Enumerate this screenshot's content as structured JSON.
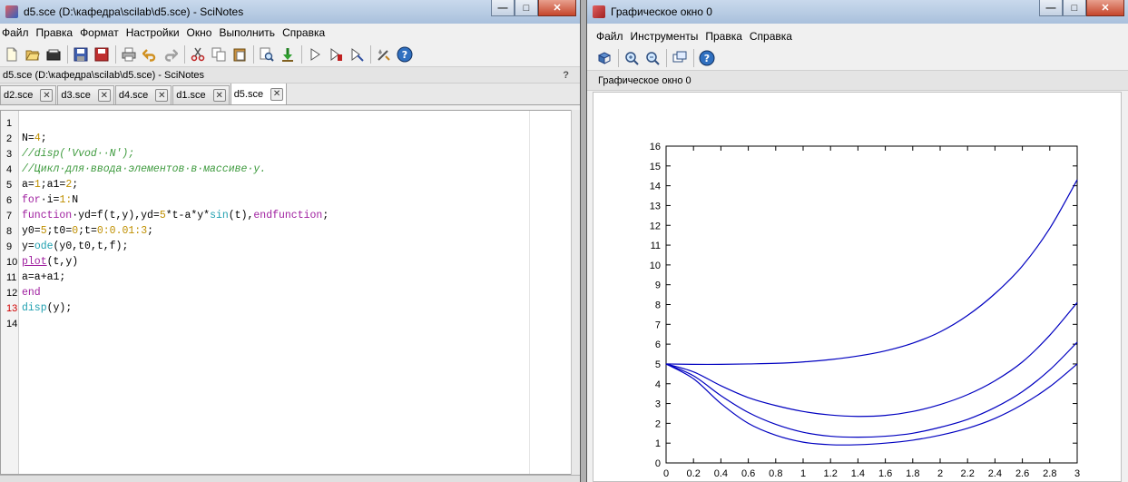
{
  "scinotes": {
    "window_title": "d5.sce (D:\\кафедра\\scilab\\d5.sce) - SciNotes",
    "menu": [
      "Файл",
      "Правка",
      "Формат",
      "Настройки",
      "Окно",
      "Выполнить",
      "Справка"
    ],
    "toolbar_icons": [
      "new-file-icon",
      "open-file-icon",
      "open-file-alt-icon",
      "save-icon",
      "save-as-icon",
      "print-icon",
      "undo-icon",
      "redo-icon",
      "cut-icon",
      "copy-icon",
      "paste-icon",
      "find-icon",
      "execute-file-icon",
      "run-icon",
      "run-until-icon",
      "run-all-icon",
      "console-icon",
      "help-icon"
    ],
    "sub_title": "d5.sce (D:\\кафедра\\scilab\\d5.sce) - SciNotes",
    "sub_help": "?",
    "tabs": [
      {
        "label": "d2.sce",
        "active": false
      },
      {
        "label": "d3.sce",
        "active": false
      },
      {
        "label": "d4.sce",
        "active": false
      },
      {
        "label": "d1.sce",
        "active": false
      },
      {
        "label": "d5.sce",
        "active": true
      }
    ],
    "lines": [
      {
        "n": "1",
        "tokens": []
      },
      {
        "n": "2",
        "tokens": [
          [
            "def",
            "N="
          ],
          [
            "num",
            "4"
          ],
          [
            "def",
            ";"
          ]
        ]
      },
      {
        "n": "3",
        "tokens": [
          [
            "cmt",
            "//disp('Vvod··N');"
          ]
        ]
      },
      {
        "n": "4",
        "tokens": [
          [
            "cmt",
            "//Цикл·для·ввода·элементов·в·массиве·y."
          ]
        ]
      },
      {
        "n": "5",
        "tokens": [
          [
            "def",
            "a="
          ],
          [
            "num",
            "1"
          ],
          [
            "def",
            ";a1="
          ],
          [
            "num",
            "2"
          ],
          [
            "def",
            ";"
          ]
        ]
      },
      {
        "n": "6",
        "tokens": [
          [
            "kw",
            "for"
          ],
          [
            "def",
            "·i="
          ],
          [
            "num",
            "1"
          ],
          [
            "num",
            ":"
          ],
          [
            "def",
            "N"
          ]
        ]
      },
      {
        "n": "7",
        "tokens": [
          [
            "kw",
            "function"
          ],
          [
            "def",
            "·yd=f(t,y),yd="
          ],
          [
            "num",
            "5"
          ],
          [
            "def",
            "*t-a*y*"
          ],
          [
            "fn",
            "sin"
          ],
          [
            "def",
            "(t),"
          ],
          [
            "kw",
            "endfunction"
          ],
          [
            "def",
            ";"
          ]
        ]
      },
      {
        "n": "8",
        "tokens": [
          [
            "def",
            "y0="
          ],
          [
            "num",
            "5"
          ],
          [
            "def",
            ";t0="
          ],
          [
            "num",
            "0"
          ],
          [
            "def",
            ";t="
          ],
          [
            "num",
            "0"
          ],
          [
            "num",
            ":"
          ],
          [
            "num",
            "0.01"
          ],
          [
            "num",
            ":"
          ],
          [
            "num",
            "3"
          ],
          [
            "def",
            ";"
          ]
        ]
      },
      {
        "n": "9",
        "tokens": [
          [
            "def",
            "y="
          ],
          [
            "fn",
            "ode"
          ],
          [
            "def",
            "(y0,t0,t,f);"
          ]
        ]
      },
      {
        "n": "10",
        "tokens": [
          [
            "macro",
            "plot"
          ],
          [
            "def",
            "(t,y)"
          ]
        ]
      },
      {
        "n": "11",
        "tokens": [
          [
            "def",
            "a=a+a1;"
          ]
        ]
      },
      {
        "n": "12",
        "tokens": [
          [
            "kw",
            "end"
          ]
        ]
      },
      {
        "n": "13",
        "tokens": [
          [
            "fn",
            "disp"
          ],
          [
            "def",
            "(y);"
          ]
        ],
        "current": true
      },
      {
        "n": "14",
        "tokens": []
      }
    ]
  },
  "graphic": {
    "window_title": "Графическое окно 0",
    "menu": [
      "Файл",
      "Инструменты",
      "Правка",
      "Справка"
    ],
    "toolbar_icons": [
      "rotate-icon",
      "zoom-in-icon",
      "zoom-out-icon",
      "datatip-icon",
      "help-icon"
    ],
    "sub_title": "Графическое окно 0"
  },
  "chart_data": {
    "type": "line",
    "title": "",
    "xlabel": "",
    "ylabel": "",
    "xlim": [
      0,
      3
    ],
    "ylim": [
      0,
      16
    ],
    "x_ticks": [
      "0",
      "0.2",
      "0.4",
      "0.6",
      "0.8",
      "1",
      "1.2",
      "1.4",
      "1.6",
      "1.8",
      "2",
      "2.2",
      "2.4",
      "2.6",
      "2.8",
      "3"
    ],
    "y_ticks": [
      "0",
      "1",
      "2",
      "3",
      "4",
      "5",
      "6",
      "7",
      "8",
      "9",
      "10",
      "11",
      "12",
      "13",
      "14",
      "15",
      "16"
    ],
    "grid": false,
    "line_color": "#0000c0",
    "series": [
      {
        "x": [
          0,
          0.2,
          0.4,
          0.6,
          0.8,
          1.0,
          1.2,
          1.4,
          1.6,
          1.8,
          2.0,
          2.2,
          2.4,
          2.6,
          2.8,
          3.0
        ],
        "values": [
          5.0,
          4.98,
          4.98,
          5.0,
          5.03,
          5.1,
          5.22,
          5.4,
          5.66,
          6.05,
          6.62,
          7.45,
          8.55,
          9.95,
          11.85,
          14.3
        ]
      },
      {
        "x": [
          0,
          0.2,
          0.4,
          0.6,
          0.8,
          1.0,
          1.2,
          1.4,
          1.6,
          1.8,
          2.0,
          2.2,
          2.4,
          2.6,
          2.8,
          3.0
        ],
        "values": [
          5.0,
          4.6,
          3.9,
          3.3,
          2.9,
          2.6,
          2.42,
          2.35,
          2.4,
          2.6,
          2.95,
          3.45,
          4.15,
          5.1,
          6.45,
          8.1
        ]
      },
      {
        "x": [
          0,
          0.2,
          0.4,
          0.6,
          0.8,
          1.0,
          1.2,
          1.4,
          1.6,
          1.8,
          2.0,
          2.2,
          2.4,
          2.6,
          2.8,
          3.0
        ],
        "values": [
          5.0,
          4.4,
          3.4,
          2.55,
          1.95,
          1.55,
          1.35,
          1.3,
          1.35,
          1.5,
          1.8,
          2.2,
          2.8,
          3.6,
          4.7,
          6.1
        ]
      },
      {
        "x": [
          0,
          0.2,
          0.4,
          0.6,
          0.8,
          1.0,
          1.2,
          1.4,
          1.6,
          1.8,
          2.0,
          2.2,
          2.4,
          2.6,
          2.8,
          3.0
        ],
        "values": [
          5.0,
          4.25,
          3.0,
          2.0,
          1.4,
          1.05,
          0.92,
          0.92,
          1.0,
          1.15,
          1.4,
          1.75,
          2.25,
          2.95,
          3.85,
          5.0
        ]
      }
    ]
  }
}
